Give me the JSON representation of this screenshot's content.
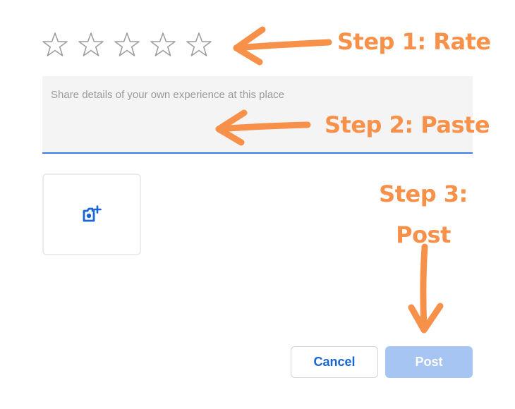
{
  "rating": {
    "stars": [
      {
        "icon": "star-outline-icon"
      },
      {
        "icon": "star-outline-icon"
      },
      {
        "icon": "star-outline-icon"
      },
      {
        "icon": "star-outline-icon"
      },
      {
        "icon": "star-outline-icon"
      }
    ]
  },
  "review": {
    "placeholder": "Share details of your own experience at this place",
    "value": ""
  },
  "photo": {
    "icon": "add-photo-icon"
  },
  "actions": {
    "cancel_label": "Cancel",
    "post_label": "Post"
  },
  "annotations": {
    "step1": "Step 1: Rate",
    "step2": "Step 2: Paste",
    "step3": "Step 3: Post"
  },
  "colors": {
    "annotation": "#f7914a",
    "accent": "#3b7de6",
    "post_disabled": "#a6c5f2",
    "cancel_text": "#1a66d2"
  }
}
